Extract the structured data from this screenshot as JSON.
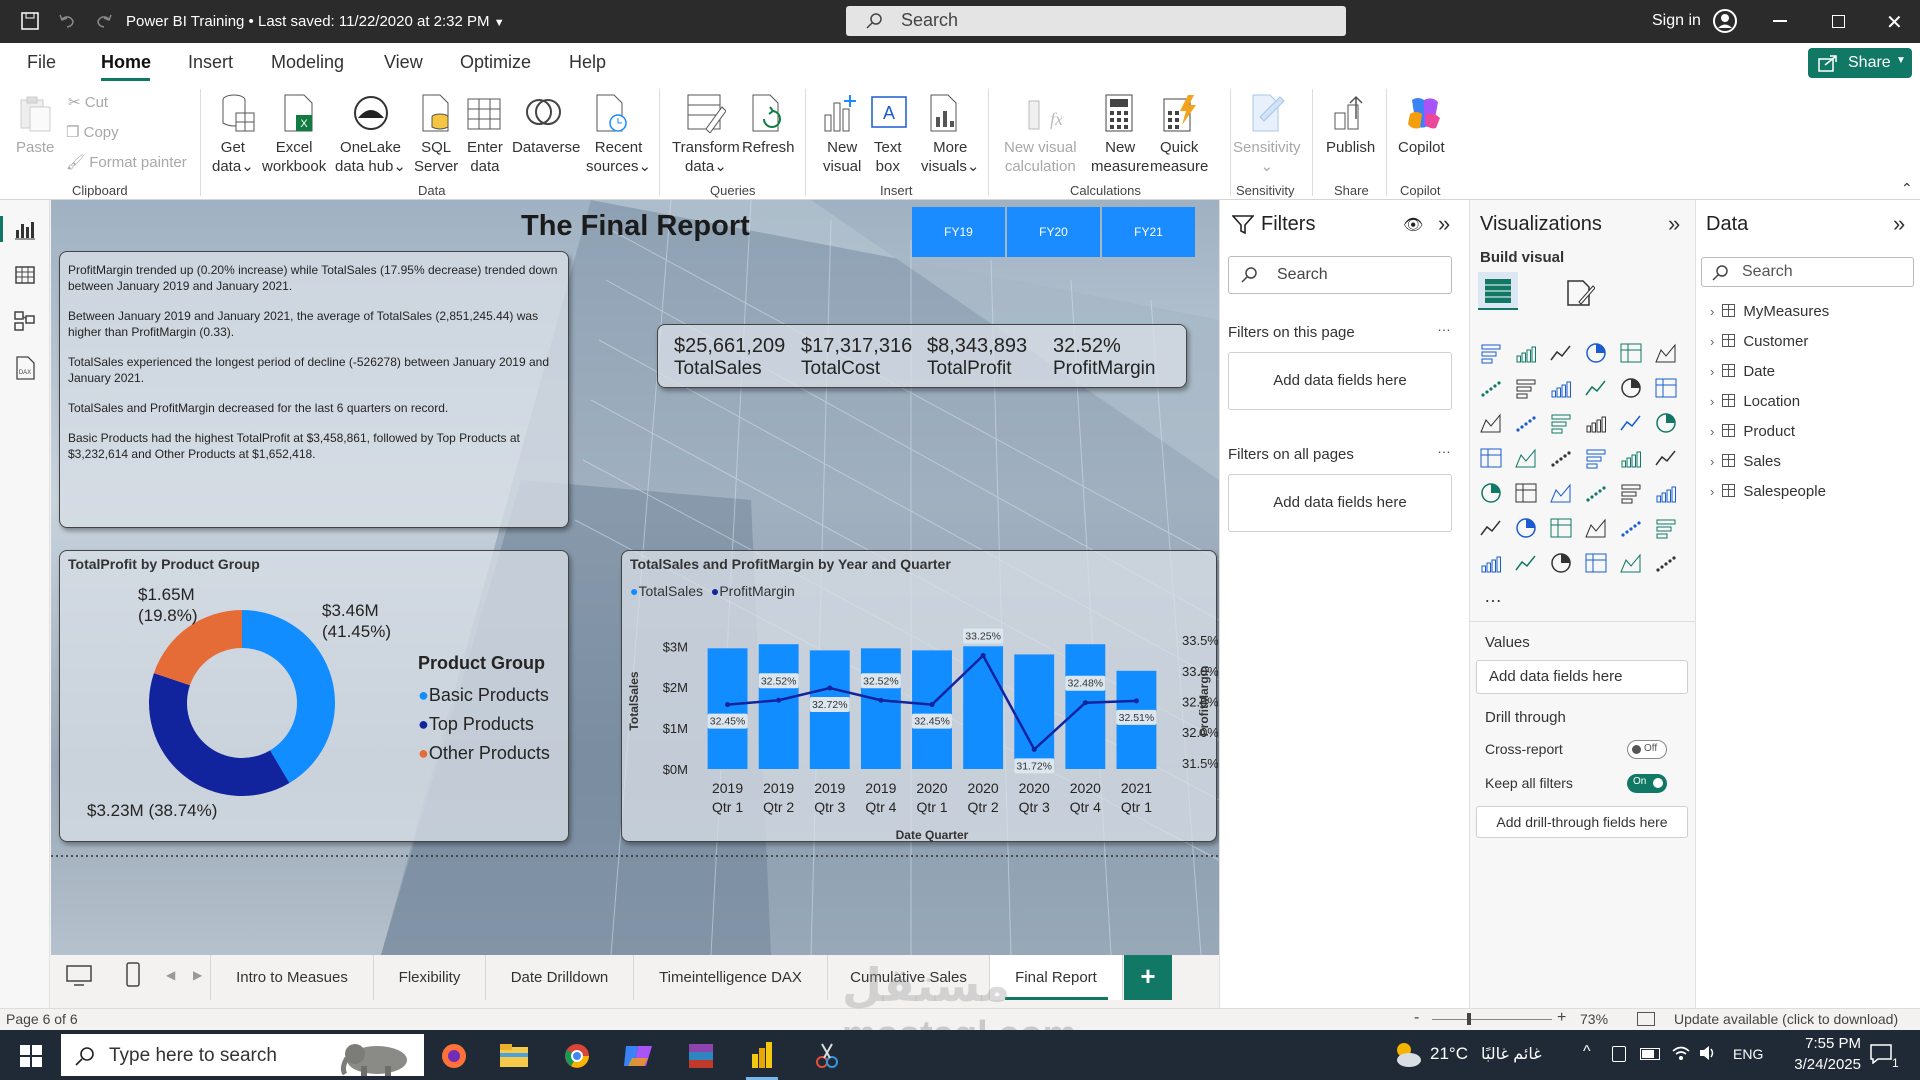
{
  "titlebar": {
    "doc_title": "Power BI Training",
    "saved": "Last saved: 11/22/2020 at 2:32 PM",
    "search_placeholder": "Search",
    "signin": "Sign in"
  },
  "menu": {
    "items": [
      "File",
      "Home",
      "Insert",
      "Modeling",
      "View",
      "Optimize",
      "Help"
    ],
    "active": "Home",
    "share": "Share"
  },
  "ribbon": {
    "clipboard": {
      "paste": "Paste",
      "cut": "Cut",
      "copy": "Copy",
      "format_painter": "Format painter",
      "group": "Clipboard"
    },
    "data": {
      "get_data": [
        "Get",
        "data"
      ],
      "excel": [
        "Excel",
        "workbook"
      ],
      "onelake": [
        "OneLake",
        "data hub"
      ],
      "sql": [
        "SQL",
        "Server"
      ],
      "enter": [
        "Enter",
        "data"
      ],
      "dataverse": "Dataverse",
      "recent": [
        "Recent",
        "sources"
      ],
      "group": "Data"
    },
    "queries": {
      "transform": [
        "Transform",
        "data"
      ],
      "refresh": "Refresh",
      "group": "Queries"
    },
    "insert": {
      "new_visual": [
        "New",
        "visual"
      ],
      "text_box": [
        "Text",
        "box"
      ],
      "more_visuals": [
        "More",
        "visuals"
      ],
      "group": "Insert"
    },
    "calculations": {
      "new_visual_calc": [
        "New visual",
        "calculation"
      ],
      "new_measure": [
        "New",
        "measure"
      ],
      "quick_measure": [
        "Quick",
        "measure"
      ],
      "group": "Calculations"
    },
    "sensitivity": {
      "label": "Sensitivity",
      "group": "Sensitivity"
    },
    "share": {
      "publish": "Publish",
      "group": "Share"
    },
    "copilot": {
      "label": "Copilot",
      "group": "Copilot"
    }
  },
  "report": {
    "title": "The Final Report",
    "slicer": [
      "FY19",
      "FY20",
      "FY21"
    ],
    "kpis": [
      {
        "value": "$25,661,209",
        "label": "TotalSales"
      },
      {
        "value": "$17,317,316",
        "label": "TotalCost"
      },
      {
        "value": "$8,343,893",
        "label": "TotalProfit"
      },
      {
        "value": "32.52%",
        "label": "ProfitMargin"
      }
    ],
    "narrative": [
      "ProfitMargin trended up (0.20% increase) while TotalSales (17.95% decrease) trended down between January 2019 and January 2021.",
      "Between January 2019 and January 2021, the average of TotalSales (2,851,245.44) was higher than ProfitMargin (0.33).",
      "TotalSales experienced the longest period of decline (-526278) between January 2019 and January 2021.",
      "TotalSales and ProfitMargin decreased for the last 6 quarters on record.",
      "Basic Products had the highest TotalProfit at $3,458,861, followed by Top Products at $3,232,614 and Other Products at $1,652,418."
    ]
  },
  "chart_data": [
    {
      "type": "pie",
      "title": "TotalProfit by Product Group",
      "legend_title": "Product Group",
      "categories": [
        "Basic Products",
        "Top Products",
        "Other Products"
      ],
      "values": [
        3.46,
        3.23,
        1.65
      ],
      "value_labels": [
        "$3.46M",
        "$3.23M",
        "$1.65M"
      ],
      "percent_labels": [
        "(41.45%)",
        "(38.74%)",
        "(19.8%)"
      ],
      "colors": [
        "#118dff",
        "#12239e",
        "#e66c37"
      ],
      "donut": true
    },
    {
      "type": "bar",
      "title": "TotalSales and ProfitMargin by Year and Quarter",
      "xlabel": "Date Quarter",
      "ylabel": "TotalSales",
      "y2label": "ProfitMargin",
      "categories": [
        [
          "2019",
          "Qtr 1"
        ],
        [
          "2019",
          "Qtr 2"
        ],
        [
          "2019",
          "Qtr 3"
        ],
        [
          "2019",
          "Qtr 4"
        ],
        [
          "2020",
          "Qtr 1"
        ],
        [
          "2020",
          "Qtr 2"
        ],
        [
          "2020",
          "Qtr 3"
        ],
        [
          "2020",
          "Qtr 4"
        ],
        [
          "2021",
          "Qtr 1"
        ]
      ],
      "series": [
        {
          "name": "TotalSales",
          "type": "bar",
          "color": "#118dff",
          "values": [
            2.95,
            3.05,
            2.9,
            2.95,
            2.9,
            3.0,
            2.8,
            3.05,
            2.4
          ]
        },
        {
          "name": "ProfitMargin",
          "type": "line",
          "color": "#12239e",
          "values": [
            32.45,
            32.52,
            32.72,
            32.52,
            32.45,
            33.25,
            31.72,
            32.48,
            32.51
          ],
          "labels": [
            "32.45%",
            "32.52%",
            "32.72%",
            "32.52%",
            "32.45%",
            "33.25%",
            "31.72%",
            "32.48%",
            "32.51%"
          ]
        }
      ],
      "ylim": [
        0,
        3.3
      ],
      "yticks": [
        "$0M",
        "$1M",
        "$2M",
        "$3M"
      ],
      "y2lim": [
        31.4,
        33.6
      ],
      "y2ticks": [
        "31.5%",
        "32.0%",
        "32.5%",
        "33.0%",
        "33.5%"
      ]
    }
  ],
  "tabs": [
    "Intro to Measues",
    "Flexibility",
    "Date Drilldown",
    "Timeintelligence DAX",
    "Cumulative Sales",
    "Final Report"
  ],
  "active_tab": "Final Report",
  "filters": {
    "title": "Filters",
    "search": "Search",
    "this_page": "Filters on this page",
    "all_pages": "Filters on all pages",
    "add_fields": "Add data fields here"
  },
  "visualizations": {
    "title": "Visualizations",
    "build": "Build visual",
    "values": "Values",
    "add_fields": "Add data fields here",
    "drill": "Drill through",
    "cross_report": "Cross-report",
    "cross_state": "Off",
    "keep_filters": "Keep all filters",
    "keep_state": "On",
    "add_drill": "Add drill-through fields here"
  },
  "data_pane": {
    "title": "Data",
    "search": "Search",
    "tables": [
      "MyMeasures",
      "Customer",
      "Date",
      "Location",
      "Product",
      "Sales",
      "Salespeople"
    ]
  },
  "status": {
    "page": "Page 6 of 6",
    "zoom": "73%",
    "update": "Update available (click to download)"
  },
  "taskbar": {
    "search": "Type here to search",
    "weather": "21°C",
    "weather_text": "غائم غالبًا",
    "lang": "ENG",
    "time": "7:55 PM",
    "date": "3/24/2025",
    "notif": "1"
  },
  "watermark": {
    "text": "mostaql.com",
    "arabic": "مستقل"
  },
  "colors": {
    "accent": "#1a8cff",
    "share_green": "#117865",
    "tab_add": "#117865"
  }
}
